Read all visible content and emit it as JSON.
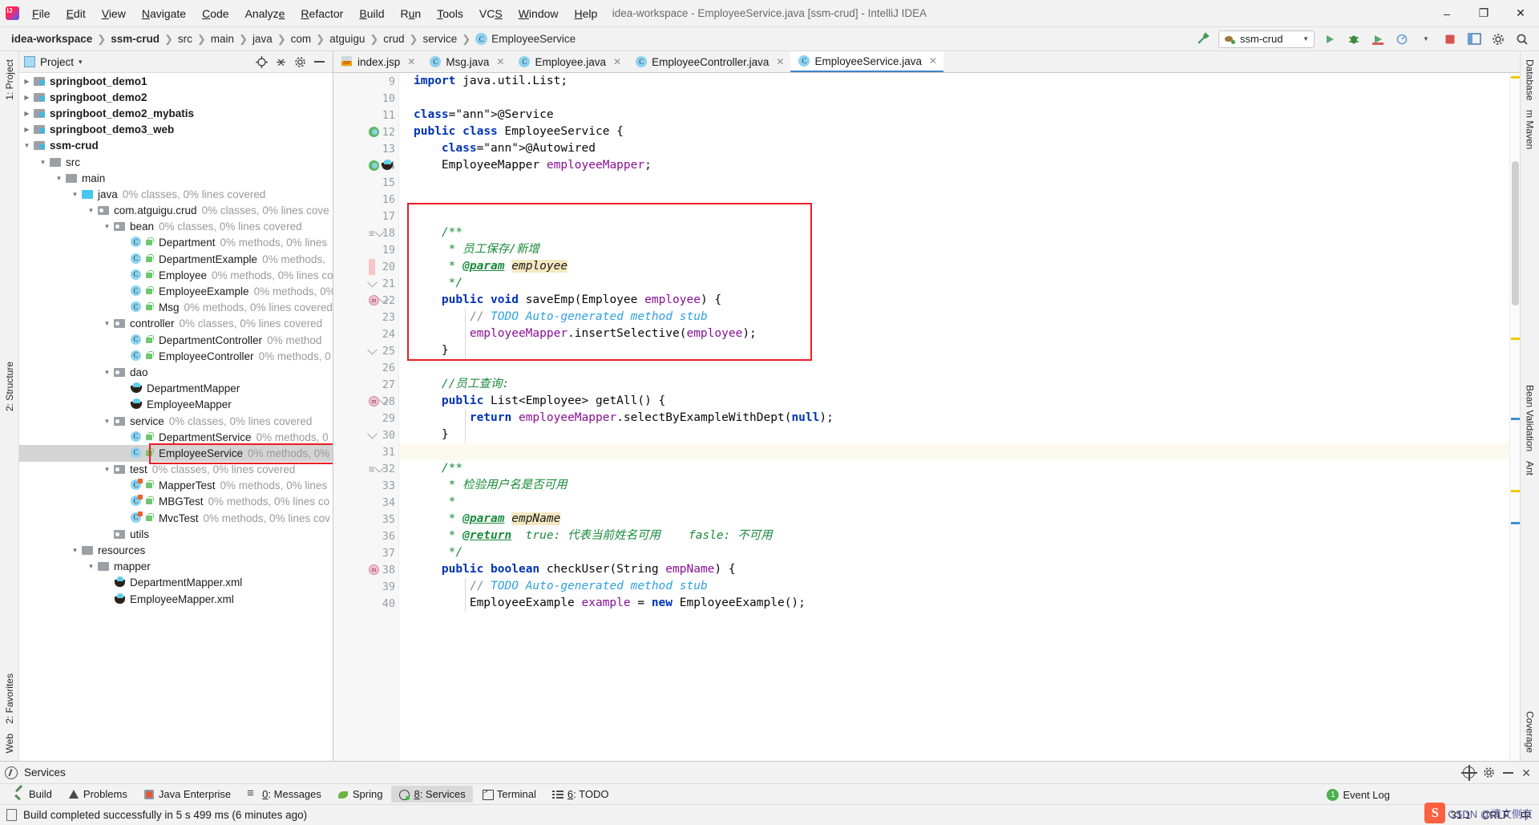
{
  "window": {
    "title": "idea-workspace - EmployeeService.java [ssm-crud] - IntelliJ IDEA",
    "minimize": "–",
    "maximize": "❐",
    "close": "✕"
  },
  "menu": [
    "File",
    "Edit",
    "View",
    "Navigate",
    "Code",
    "Analyze",
    "Refactor",
    "Build",
    "Run",
    "Tools",
    "VCS",
    "Window",
    "Help"
  ],
  "breadcrumb": {
    "segments": [
      "idea-workspace",
      "ssm-crud",
      "src",
      "main",
      "java",
      "com",
      "atguigu",
      "crud",
      "service"
    ],
    "class_name": "EmployeeService"
  },
  "toolbar": {
    "run_config": "ssm-crud",
    "hammer_icon": "build-hammer-icon",
    "run_icon": "run-icon",
    "debug_icon": "debug-icon",
    "coverage_icon": "run-with-coverage-icon",
    "profiler_icon": "profiler-icon",
    "stop_icon": "stop-icon",
    "layout_icon": "layout-icon",
    "settings_icon": "settings-icon",
    "search_icon": "search-everywhere-icon"
  },
  "left_rail": {
    "top": [
      "1: Project"
    ],
    "mid": [
      "2: Structure"
    ],
    "bottom": [
      "2: Favorites",
      "Web"
    ]
  },
  "right_rail": {
    "top": [
      "Database",
      "m Maven"
    ],
    "mid": [
      "Bean Validation",
      "Ant"
    ],
    "bottom": [
      "Coverage"
    ]
  },
  "project_panel": {
    "title": "Project",
    "caret": "▾",
    "locate_icon": "locate-icon",
    "collapse_icon": "collapse-all-icon",
    "settings_icon": "gear-icon",
    "hide_icon": "hide-icon",
    "tree": [
      {
        "depth": 1,
        "arrow": "collapsed",
        "icon": "module",
        "label": "springboot_demo1",
        "bold": true,
        "cov": ""
      },
      {
        "depth": 1,
        "arrow": "collapsed",
        "icon": "module",
        "label": "springboot_demo2",
        "bold": true,
        "cov": ""
      },
      {
        "depth": 1,
        "arrow": "collapsed",
        "icon": "module",
        "label": "springboot_demo2_mybatis",
        "bold": true,
        "cov": ""
      },
      {
        "depth": 1,
        "arrow": "collapsed",
        "icon": "module",
        "label": "springboot_demo3_web",
        "bold": true,
        "cov": ""
      },
      {
        "depth": 1,
        "arrow": "expanded",
        "icon": "module",
        "label": "ssm-crud",
        "bold": true,
        "cov": ""
      },
      {
        "depth": 2,
        "arrow": "expanded",
        "icon": "folder",
        "label": "src",
        "bold": false,
        "cov": ""
      },
      {
        "depth": 3,
        "arrow": "expanded",
        "icon": "folder",
        "label": "main",
        "bold": false,
        "cov": ""
      },
      {
        "depth": 4,
        "arrow": "expanded",
        "icon": "source",
        "label": "java",
        "bold": false,
        "cov": "0% classes, 0% lines covered"
      },
      {
        "depth": 5,
        "arrow": "expanded",
        "icon": "package",
        "label": "com.atguigu.crud",
        "bold": false,
        "cov": "0% classes, 0% lines cove"
      },
      {
        "depth": 6,
        "arrow": "expanded",
        "icon": "package",
        "label": "bean",
        "bold": false,
        "cov": "0% classes, 0% lines covered"
      },
      {
        "depth": 7,
        "arrow": "none",
        "icon": "class",
        "label": "Department",
        "bold": false,
        "cov": "0% methods, 0% lines"
      },
      {
        "depth": 7,
        "arrow": "none",
        "icon": "class",
        "label": "DepartmentExample",
        "bold": false,
        "cov": "0% methods,"
      },
      {
        "depth": 7,
        "arrow": "none",
        "icon": "class",
        "label": "Employee",
        "bold": false,
        "cov": "0% methods, 0% lines co"
      },
      {
        "depth": 7,
        "arrow": "none",
        "icon": "class",
        "label": "EmployeeExample",
        "bold": false,
        "cov": "0% methods, 0%"
      },
      {
        "depth": 7,
        "arrow": "none",
        "icon": "class",
        "label": "Msg",
        "bold": false,
        "cov": "0% methods, 0% lines covered"
      },
      {
        "depth": 6,
        "arrow": "expanded",
        "icon": "package",
        "label": "controller",
        "bold": false,
        "cov": "0% classes, 0% lines covered"
      },
      {
        "depth": 7,
        "arrow": "none",
        "icon": "class",
        "label": "DepartmentController",
        "bold": false,
        "cov": "0% method"
      },
      {
        "depth": 7,
        "arrow": "none",
        "icon": "class",
        "label": "EmployeeController",
        "bold": false,
        "cov": "0% methods, 0"
      },
      {
        "depth": 6,
        "arrow": "expanded",
        "icon": "package",
        "label": "dao",
        "bold": false,
        "cov": ""
      },
      {
        "depth": 7,
        "arrow": "none",
        "icon": "mapper",
        "label": "DepartmentMapper",
        "bold": false,
        "cov": ""
      },
      {
        "depth": 7,
        "arrow": "none",
        "icon": "mapper",
        "label": "EmployeeMapper",
        "bold": false,
        "cov": ""
      },
      {
        "depth": 6,
        "arrow": "expanded",
        "icon": "package",
        "label": "service",
        "bold": false,
        "cov": "0% classes, 0% lines covered"
      },
      {
        "depth": 7,
        "arrow": "none",
        "icon": "class",
        "label": "DepartmentService",
        "bold": false,
        "cov": "0% methods, 0"
      },
      {
        "depth": 7,
        "arrow": "none",
        "icon": "class",
        "label": "EmployeeService",
        "bold": false,
        "cov": "0% methods, 0%",
        "selected": true,
        "highlighted": true
      },
      {
        "depth": 6,
        "arrow": "expanded",
        "icon": "package",
        "label": "test",
        "bold": false,
        "cov": "0% classes, 0% lines covered"
      },
      {
        "depth": 7,
        "arrow": "none",
        "icon": "testclass",
        "label": "MapperTest",
        "bold": false,
        "cov": "0% methods, 0% lines"
      },
      {
        "depth": 7,
        "arrow": "none",
        "icon": "testclass",
        "label": "MBGTest",
        "bold": false,
        "cov": "0% methods, 0% lines co"
      },
      {
        "depth": 7,
        "arrow": "none",
        "icon": "testclass",
        "label": "MvcTest",
        "bold": false,
        "cov": "0% methods, 0% lines cov"
      },
      {
        "depth": 6,
        "arrow": "none",
        "icon": "package",
        "label": "utils",
        "bold": false,
        "cov": ""
      },
      {
        "depth": 4,
        "arrow": "expanded",
        "icon": "folder",
        "label": "resources",
        "bold": false,
        "cov": ""
      },
      {
        "depth": 5,
        "arrow": "expanded",
        "icon": "folder",
        "label": "mapper",
        "bold": false,
        "cov": ""
      },
      {
        "depth": 6,
        "arrow": "none",
        "icon": "xml",
        "label": "DepartmentMapper.xml",
        "bold": false,
        "cov": ""
      },
      {
        "depth": 6,
        "arrow": "none",
        "icon": "xml",
        "label": "EmployeeMapper.xml",
        "bold": false,
        "cov": ""
      }
    ]
  },
  "editor": {
    "tabs": [
      {
        "label": "index.jsp",
        "icon": "jsp-file-icon",
        "active": false
      },
      {
        "label": "Msg.java",
        "icon": "java-class-icon",
        "active": false
      },
      {
        "label": "Employee.java",
        "icon": "java-class-icon",
        "active": false
      },
      {
        "label": "EmployeeController.java",
        "icon": "java-class-icon",
        "active": false
      },
      {
        "label": "EmployeeService.java",
        "icon": "java-class-icon",
        "active": true
      }
    ],
    "first_line": 9,
    "lines": [
      {
        "n": 9,
        "text": "import java.util.List;"
      },
      {
        "n": 10,
        "text": ""
      },
      {
        "n": 11,
        "text": "@Service"
      },
      {
        "n": 12,
        "text": "public class EmployeeService {"
      },
      {
        "n": 13,
        "text": "    @Autowired"
      },
      {
        "n": 14,
        "text": "    EmployeeMapper employeeMapper;"
      },
      {
        "n": 15,
        "text": ""
      },
      {
        "n": 16,
        "text": ""
      },
      {
        "n": 17,
        "text": ""
      },
      {
        "n": 18,
        "text": "    /**"
      },
      {
        "n": 19,
        "text": "     * 员工保存/新增"
      },
      {
        "n": 20,
        "text": "     * @param employee"
      },
      {
        "n": 21,
        "text": "     */"
      },
      {
        "n": 22,
        "text": "    public void saveEmp(Employee employee) {"
      },
      {
        "n": 23,
        "text": "        // TODO Auto-generated method stub"
      },
      {
        "n": 24,
        "text": "        employeeMapper.insertSelective(employee);"
      },
      {
        "n": 25,
        "text": "    }"
      },
      {
        "n": 26,
        "text": ""
      },
      {
        "n": 27,
        "text": "    //员工查询:"
      },
      {
        "n": 28,
        "text": "    public List<Employee> getAll() {"
      },
      {
        "n": 29,
        "text": "        return employeeMapper.selectByExampleWithDept(null);"
      },
      {
        "n": 30,
        "text": "    }"
      },
      {
        "n": 31,
        "text": "",
        "current": true
      },
      {
        "n": 32,
        "text": "    /**"
      },
      {
        "n": 33,
        "text": "     * 检验用户名是否可用"
      },
      {
        "n": 34,
        "text": "     *"
      },
      {
        "n": 35,
        "text": "     * @param empName"
      },
      {
        "n": 36,
        "text": "     * @return  true: 代表当前姓名可用    fasle: 不可用"
      },
      {
        "n": 37,
        "text": "     */"
      },
      {
        "n": 38,
        "text": "    public boolean checkUser(String empName) {"
      },
      {
        "n": 39,
        "text": "        // TODO Auto-generated method stub"
      },
      {
        "n": 40,
        "text": "        EmployeeExample example = new EmployeeExample();"
      }
    ],
    "highlight_box_label": "saveEmp-method-highlight"
  },
  "services_panel": {
    "title": "Services",
    "settings_icon": "gear-icon",
    "target_icon": "target-icon",
    "minimize_icon": "minimize-icon",
    "close_icon": "close-icon"
  },
  "tool_windows": [
    {
      "label": "Build",
      "icon": "build-icon",
      "active": false,
      "mnemonic": ""
    },
    {
      "label": "Problems",
      "icon": "problems-icon",
      "active": false,
      "mnemonic": ""
    },
    {
      "label": "Java Enterprise",
      "icon": "java-enterprise-icon",
      "active": false,
      "mnemonic": ""
    },
    {
      "label": "0: Messages",
      "icon": "messages-icon",
      "active": false,
      "mnemonic": "0"
    },
    {
      "label": "Spring",
      "icon": "spring-icon",
      "active": false,
      "mnemonic": ""
    },
    {
      "label": "8: Services",
      "icon": "services-icon",
      "active": true,
      "mnemonic": "8"
    },
    {
      "label": "Terminal",
      "icon": "terminal-icon",
      "active": false,
      "mnemonic": ""
    },
    {
      "label": "6: TODO",
      "icon": "todo-icon",
      "active": false,
      "mnemonic": "6"
    }
  ],
  "status": {
    "message": "Build completed successfully in 5 s 499 ms (6 minutes ago)",
    "caret_position": "31:1",
    "line_separator": "CRLF",
    "event_log": "Event Log",
    "event_count": "1",
    "ime_indicator": "中",
    "watermark": "CSDN @清文侧京"
  }
}
